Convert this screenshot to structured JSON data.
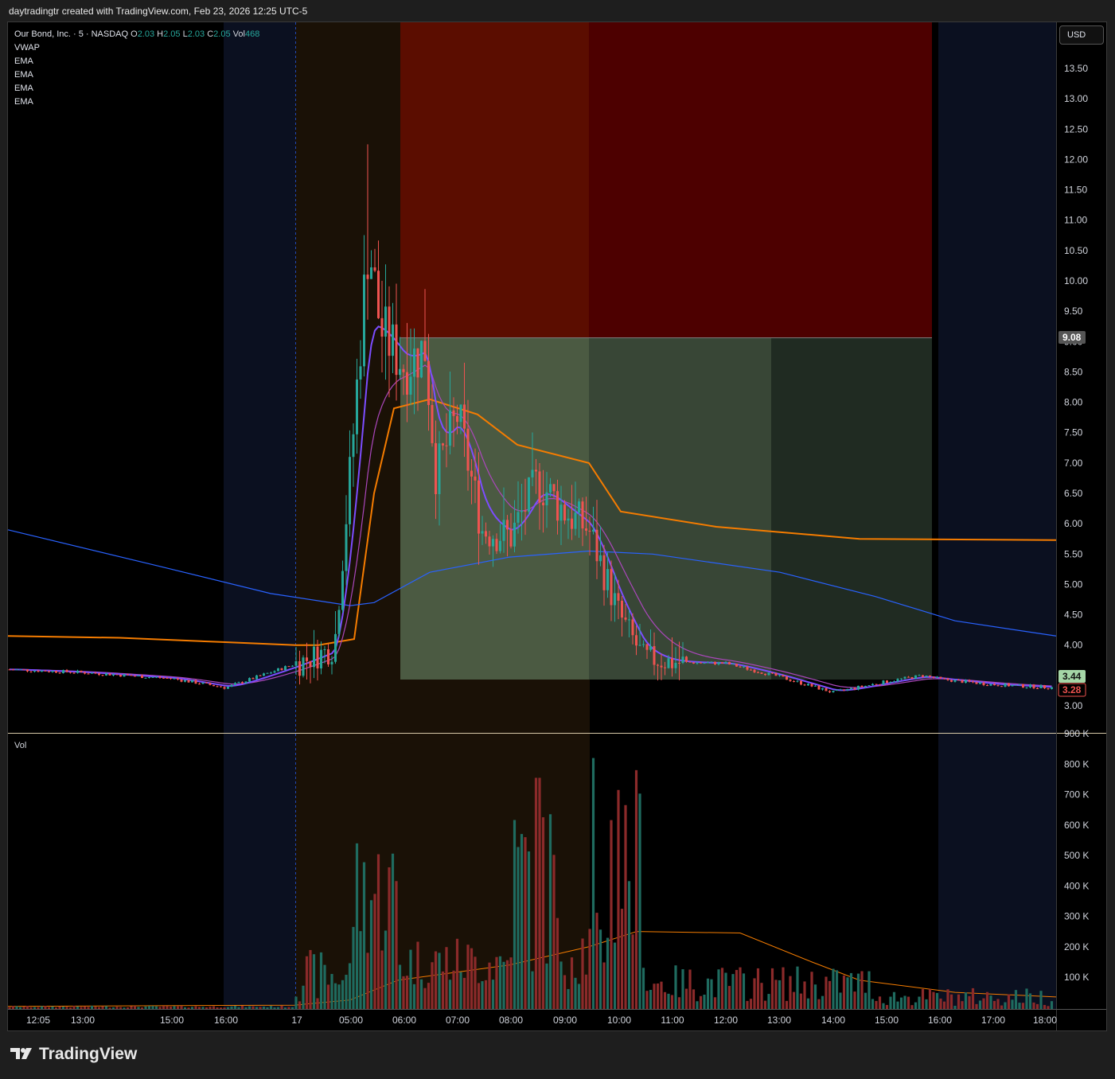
{
  "attribution": "daytradingtr created with TradingView.com, Feb 23, 2026 12:25 UTC-5",
  "brand": "TradingView",
  "currency_button": "USD",
  "legend": {
    "symbol": "Our Bond, Inc. · 5 · NASDAQ",
    "o_label": "O",
    "o": "2.03",
    "h_label": "H",
    "h": "2.05",
    "l_label": "L",
    "l": "2.03",
    "c_label": "C",
    "c": "2.05",
    "vol_label": "Vol",
    "vol": "468",
    "indicators": [
      "VWAP",
      "EMA",
      "EMA",
      "EMA",
      "EMA"
    ]
  },
  "volume_pane_label": "Vol",
  "colors": {
    "up": "#26a69a",
    "down": "#ef5350",
    "vol_up": "#1f6b5f",
    "vol_down": "#8b2a2a",
    "ema_orange": "#f57c00",
    "ema_purple": "#7c4dff",
    "ema_violet": "#ab47bc",
    "vwap_blue": "#2962ff",
    "stop_zone": "#5a0a00",
    "target_zone": "#4a5a44"
  },
  "chart_data": [
    {
      "type": "candlestick",
      "symbol": "Our Bond, Inc.",
      "interval": "5",
      "exchange": "NASDAQ",
      "x_ticks": [
        "12:05",
        "13:00",
        "15:00",
        "16:00",
        "17",
        "05:00",
        "06:00",
        "07:00",
        "08:00",
        "09:00",
        "10:00",
        "11:00",
        "12:00",
        "13:00",
        "14:00",
        "15:00",
        "16:00",
        "17:00",
        "18:00"
      ],
      "y_ticks": [
        13.5,
        13.0,
        12.5,
        12.0,
        11.5,
        11.0,
        10.5,
        10.0,
        9.5,
        9.0,
        8.5,
        8.0,
        7.5,
        7.0,
        6.5,
        6.0,
        5.5,
        5.0,
        4.5,
        4.0,
        3.5,
        3.0
      ],
      "y_tick_labels": [
        "13.50",
        "13.00",
        "12.50",
        "12.00",
        "11.50",
        "11.00",
        "10.50",
        "10.00",
        "9.50",
        "9.08",
        "8.50",
        "8.00",
        "7.50",
        "7.00",
        "6.50",
        "6.00",
        "5.50",
        "5.00",
        "4.50",
        "4.00",
        "3.44",
        "3.28",
        "3.00"
      ],
      "price_labels": {
        "stop": "9.08",
        "last_up": "3.44",
        "last_down": "3.28"
      },
      "price_points": [
        {
          "t": "12:05",
          "v": 3.6
        },
        {
          "t": "13:00",
          "v": 3.55
        },
        {
          "t": "15:00",
          "v": 3.45
        },
        {
          "t": "16:00",
          "v": 3.3
        },
        {
          "t": "17",
          "v": 3.7
        },
        {
          "t": "04:30",
          "v": 3.95
        },
        {
          "t": "05:00",
          "v": 7.0
        },
        {
          "t": "05:15",
          "v": 10.7
        },
        {
          "t": "05:30",
          "v": 9.2
        },
        {
          "t": "06:00",
          "v": 8.6
        },
        {
          "t": "06:30",
          "v": 8.9
        },
        {
          "t": "06:45",
          "v": 6.8
        },
        {
          "t": "07:00",
          "v": 7.8
        },
        {
          "t": "07:30",
          "v": 5.9
        },
        {
          "t": "08:00",
          "v": 5.8
        },
        {
          "t": "08:30",
          "v": 6.7
        },
        {
          "t": "09:00",
          "v": 6.2
        },
        {
          "t": "09:30",
          "v": 5.9
        },
        {
          "t": "10:00",
          "v": 4.5
        },
        {
          "t": "10:30",
          "v": 3.8
        },
        {
          "t": "11:00",
          "v": 3.72
        },
        {
          "t": "12:00",
          "v": 3.7
        },
        {
          "t": "13:00",
          "v": 3.48
        },
        {
          "t": "14:00",
          "v": 3.22
        },
        {
          "t": "15:00",
          "v": 3.4
        },
        {
          "t": "15:45",
          "v": 3.5
        },
        {
          "t": "16:00",
          "v": 3.44
        },
        {
          "t": "17:00",
          "v": 3.35
        },
        {
          "t": "18:00",
          "v": 3.3
        }
      ],
      "high": 12.25,
      "ema_orange_slow": [
        4.15,
        4.12,
        4.05,
        4.0,
        4.0,
        4.1,
        6.5,
        7.9,
        8.05,
        7.8,
        7.3,
        7.0,
        6.2,
        5.95,
        5.75,
        5.73
      ],
      "vwap": [
        5.9,
        5.3,
        4.85,
        4.65,
        4.7,
        5.2,
        5.45,
        5.55,
        5.5,
        5.2,
        4.8,
        4.4,
        4.15
      ],
      "zones": {
        "stop_from": 9.08,
        "stop_to": 13.92,
        "target_from": 3.44,
        "target_to": 9.08
      }
    },
    {
      "type": "bar",
      "title": "Vol",
      "y_ticks": [
        "900 K",
        "800 K",
        "700 K",
        "600 K",
        "500 K",
        "400 K",
        "300 K",
        "200 K",
        "100 K"
      ],
      "peak_values_k": [
        820,
        755,
        650,
        590,
        520,
        450,
        300
      ],
      "max": 820000
    }
  ]
}
